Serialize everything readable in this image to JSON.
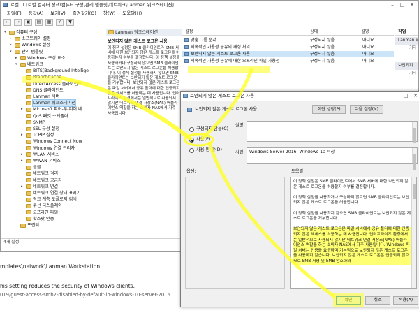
{
  "window": {
    "title": "[로컬 컴퓨터 정책\\컴퓨터 구성\\관리 템플릿\\네트워크\\Lanman 워크스테이션]",
    "title_prefix": "로컬 그"
  },
  "menubar": [
    "파일(F)",
    "동작(A)",
    "보기(V)",
    "즐겨찾기(O)",
    "창(W)",
    "도움말(H)"
  ],
  "toolbar_icons": [
    "back-icon",
    "forward-icon",
    "up-icon",
    "show-hide-icon",
    "properties-icon",
    "help-icon",
    "filter-icon"
  ],
  "tree": {
    "items": [
      {
        "label": "컴퓨터 구성",
        "indent": 1,
        "twisty": "v",
        "type": "folder"
      },
      {
        "label": "소프트웨어 설정",
        "indent": 2,
        "twisty": ">",
        "type": "folder"
      },
      {
        "label": "Windows 설정",
        "indent": 2,
        "twisty": ">",
        "type": "folder"
      },
      {
        "label": "관리 템플릿",
        "indent": 2,
        "twisty": "v",
        "type": "folder"
      },
      {
        "label": "Windows 구성 요소",
        "indent": 3,
        "twisty": ">",
        "type": "folder"
      },
      {
        "label": "네트워크",
        "indent": 3,
        "twisty": "v",
        "type": "folder"
      },
      {
        "label": "BITS(Background Intellige",
        "indent": 4,
        "twisty": "",
        "type": "folder"
      },
      {
        "label": "BranchCache",
        "indent": 4,
        "twisty": "",
        "type": "folder"
      },
      {
        "label": "DirectAccess 클라이언트",
        "indent": 4,
        "twisty": "",
        "type": "folder"
      },
      {
        "label": "DNS 클라이언트",
        "indent": 4,
        "twisty": "",
        "type": "folder"
      },
      {
        "label": "Lanman 서버",
        "indent": 4,
        "twisty": "",
        "type": "folder"
      },
      {
        "label": "Lanman 워크스테이션",
        "indent": 4,
        "twisty": "",
        "type": "folder",
        "selected": true
      },
      {
        "label": "Microsoft 피어-투-피어 네",
        "indent": 4,
        "twisty": ">",
        "type": "folder"
      },
      {
        "label": "QoS 패킷 스케줄러",
        "indent": 4,
        "twisty": "",
        "type": "folder"
      },
      {
        "label": "SNMP",
        "indent": 4,
        "twisty": "",
        "type": "folder"
      },
      {
        "label": "SSL 구성 설정",
        "indent": 4,
        "twisty": "",
        "type": "folder"
      },
      {
        "label": "TCPIP 설정",
        "indent": 4,
        "twisty": ">",
        "type": "folder"
      },
      {
        "label": "Windows Connect Now",
        "indent": 4,
        "twisty": "",
        "type": "folder"
      },
      {
        "label": "Windows 연결 관리자",
        "indent": 4,
        "twisty": "",
        "type": "folder"
      },
      {
        "label": "WLAN 서비스",
        "indent": 4,
        "twisty": ">",
        "type": "folder"
      },
      {
        "label": "WWAN 서비스",
        "indent": 4,
        "twisty": ">",
        "type": "folder"
      },
      {
        "label": "글꼴",
        "indent": 4,
        "twisty": "",
        "type": "folder"
      },
      {
        "label": "네트워크 격리",
        "indent": 4,
        "twisty": "",
        "type": "folder"
      },
      {
        "label": "네트워크 공급자",
        "indent": 4,
        "twisty": "",
        "type": "folder"
      },
      {
        "label": "네트워크 연결",
        "indent": 4,
        "twisty": ">",
        "type": "folder"
      },
      {
        "label": "네트워크 연결 상태 표시기",
        "indent": 4,
        "twisty": "",
        "type": "folder"
      },
      {
        "label": "링크 계층 토폴로지 검색",
        "indent": 4,
        "twisty": "",
        "type": "folder"
      },
      {
        "label": "무선 디스플레이",
        "indent": 4,
        "twisty": "",
        "type": "folder"
      },
      {
        "label": "오프라인 파일",
        "indent": 4,
        "twisty": "",
        "type": "folder"
      },
      {
        "label": "핫스팟 인증",
        "indent": 4,
        "twisty": "",
        "type": "folder"
      },
      {
        "label": "프린터",
        "indent": 3,
        "twisty": "",
        "type": "folder"
      }
    ]
  },
  "description_pane": {
    "header": "Lanman 워크스테이션",
    "title": "보안되지 않은 게스트 로그온 사용",
    "body": "이 정책 설정은 SMB 클라이언트가 SMB 서버에 대한 보안되지 않은 게스트 로그온을 허용하는지 여부를 결정합니다. 이 정책 설정을 사용하거나 구성하지 않으면 SMB 클라이언트는 보안되지 않은 게스트 로그온을 허용합니다. 이 정책 설정을 사용하지 않으면 SMB 클라이언트는 보안되지 않은 게스트 로그온을 거부합니다. 보안되지 않은 게스트 로그온은 파일 서버에서 공유 폴더에 대한 인증되지 않은 액세스를 허용하는 데 사용됩니다. 엔터프라이즈 환경에서는 일반적으로 사용되지 않지만 네트워크 연결 저장소(NAS) 어플라이언스 역할을 하는 소비자 NAS에서 자주 사용됩니다."
  },
  "list": {
    "columns": [
      "설정",
      "상태",
      "설명"
    ],
    "rows": [
      {
        "name": "맞춤 그룹 순서",
        "state": "구성되지 않음",
        "note": "아니요"
      },
      {
        "name": "지속적인 가용성 공유의 캐싱 처리",
        "state": "구성되지 않음",
        "note": "아니요"
      },
      {
        "name": "보안되지 않은 게스트 로그온 사용",
        "state": "구성되지 않음",
        "note": "아니요",
        "selected": true
      },
      {
        "name": "지속적인 가용성 공유에 대한 오프라인 파일 가용성",
        "state": "구성되지 않음",
        "note": "아니요"
      }
    ]
  },
  "actions_pane": {
    "header": "작업",
    "items": [
      "Lanman 워...",
      "기타",
      "보안되지 ...",
      "기타"
    ]
  },
  "statusbar": "4개 설정",
  "dialog": {
    "title": "보안되지 않은 게스트 로그온 사용",
    "setting_name": "보안되지 않은 게스트 로그온 사용",
    "prev_button": "이전 설정(P)",
    "next_button": "다음 설정(N)",
    "radios": [
      {
        "label": "구성되지 않음(C)",
        "checked": false
      },
      {
        "label": "사용(E)",
        "checked": true
      },
      {
        "label": "사용 안 함(D)",
        "checked": false
      }
    ],
    "comment_label": "설명:",
    "supported_label": "지원:",
    "supported_value": "Windows Server 2016, Windows 10 이상",
    "options_label": "옵션:",
    "help_label": "도움말:",
    "help_paragraphs": [
      "이 정책 설정은 SMB 클라이언트에서 SMB 서버에 대한 보안되지 않은 게스트 로그온을 허용할지 여부를 결정합니다.",
      "이 정책 설정을 사용하거나 구성하지 않으면 SMB 클라이언트는 보안되지 않은 게스트 로그온을 허용합니다.",
      "이 정책 설정을 사용하지 않으면 SMB 클라이언트는 보안되지 않은 게스트 로그온을 거부합니다.",
      "보안되지 않은 게스트 로그온은 파일 서버에서 공유 폴더에 대한 인증되지 않은 액세스를 허용하는 데 사용됩니다. 엔터프라이즈 환경에서는 일반적으로 사용되지 않지만 네트워크 연결 저장소(NAS) 어플라이언스 역할을 하는 소비자 NAS에서 자주 사용됩니다. Windows 파일 서버는 인증을 요구하며 기본적으로 보안되지 않은 게스트 로그온을 사용하지 않습니다. 보안되지 않은 게스트 로그온은 인증되지 않으므로 SMB 서명 및 SMB 암호화와"
    ],
    "ok_button": "확인",
    "cancel_button": "취소",
    "apply_button": "적용(A)"
  },
  "below_text": {
    "path": "mplates\\network\\Lanman Workstation",
    "sentence": "his setting reduces the security of Windows clients.",
    "url": "019/guest-access-smb2-disabled-by-default-in-windows-10-server-2016"
  },
  "colors": {
    "highlight": "#ffff28",
    "selection": "#cce4f7",
    "folder": "#e8c25a",
    "dialog_bg": "#f0f0f0"
  }
}
